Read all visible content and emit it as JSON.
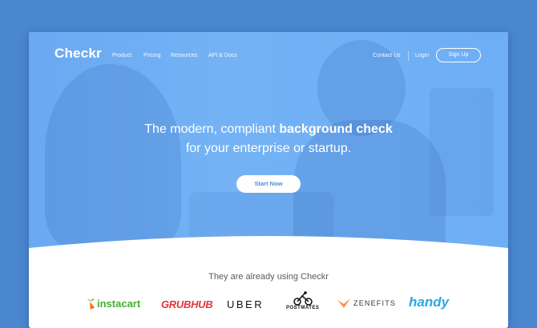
{
  "brand": "Checkr",
  "nav": {
    "links": [
      "Product",
      "Pricing",
      "Resources",
      "API & Docs"
    ],
    "contact": "Contact Us",
    "login": "Login",
    "signup": "Sign Up"
  },
  "hero": {
    "line1_pre": "The modern, compliant ",
    "line1_bold": "background check",
    "line2": "for your enterprise or startup.",
    "cta": "Start Now"
  },
  "customers": {
    "tagline": "They are already using Checkr",
    "logos": {
      "instacart": "instacart",
      "grubhub": "GRUBHUB",
      "uber": "UBER",
      "postmates": "POSTMATES",
      "zenefits": "ZENEFITS",
      "handy": "handy"
    }
  },
  "colors": {
    "page_bg": "#4a87cf",
    "hero_blue": "#6eaef4",
    "instacart_green": "#43b02a",
    "instacart_orange": "#ff7009",
    "grubhub_red": "#e0363b",
    "zenefits_orange": "#ff8a3d",
    "handy_blue": "#2ca7e6"
  },
  "icons": [
    "carrot-icon",
    "bird-icon",
    "cyclist-icon"
  ]
}
